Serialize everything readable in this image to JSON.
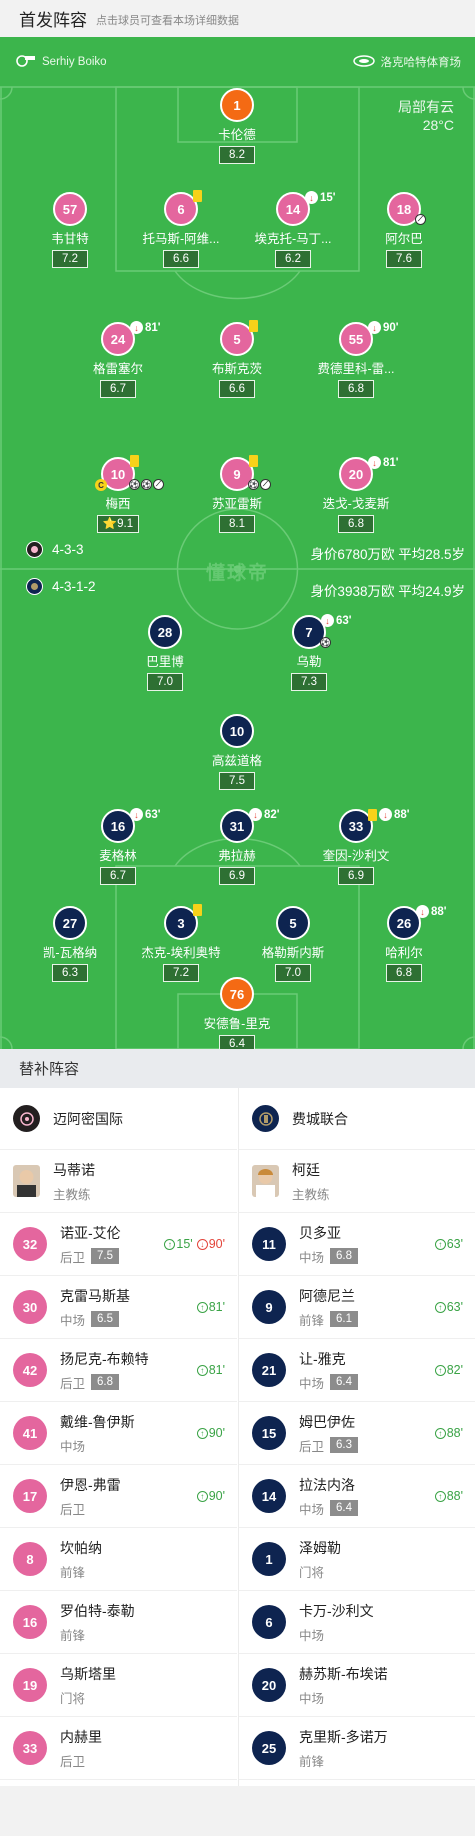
{
  "header": {
    "title": "首发阵容",
    "subtitle": "点击球员可查看本场详细数据"
  },
  "match": {
    "referee": "Serhiy Boiko",
    "stadium": "洛克哈特体育场",
    "weather": "局部有云",
    "temperature": "28°C",
    "watermark": "懂球帝"
  },
  "home": {
    "formation": "4-3-3",
    "value": "身价6780万欧 平均28.5岁"
  },
  "away": {
    "formation": "4-3-1-2",
    "value": "身价3938万欧 平均24.9岁"
  },
  "pitch_players": [
    {
      "id": "p1",
      "num": "1",
      "name": "卡伦德",
      "rating": "8.2",
      "color": "orange"
    },
    {
      "id": "p57",
      "num": "57",
      "name": "韦甘特",
      "rating": "7.2",
      "color": "pink"
    },
    {
      "id": "p6",
      "num": "6",
      "name": "托马斯-阿维...",
      "rating": "6.6",
      "color": "pink",
      "yellow": true
    },
    {
      "id": "p14",
      "num": "14",
      "name": "埃克托-马丁...",
      "rating": "6.2",
      "color": "pink",
      "sub": "15'"
    },
    {
      "id": "p18",
      "num": "18",
      "name": "阿尔巴",
      "rating": "7.6",
      "color": "pink",
      "assist": true
    },
    {
      "id": "p24",
      "num": "24",
      "name": "格雷塞尔",
      "rating": "6.7",
      "color": "pink",
      "sub": "81'"
    },
    {
      "id": "p5",
      "num": "5",
      "name": "布斯克茨",
      "rating": "6.6",
      "color": "pink",
      "yellow": true
    },
    {
      "id": "p55",
      "num": "55",
      "name": "费德里科-雷...",
      "rating": "6.8",
      "color": "pink",
      "sub": "90'"
    },
    {
      "id": "p10",
      "num": "10",
      "name": "梅西",
      "rating": "9.1",
      "color": "pink",
      "yellow": true,
      "captain": "C",
      "star": "⭐"
    },
    {
      "id": "p9",
      "num": "9",
      "name": "苏亚雷斯",
      "rating": "8.1",
      "color": "pink",
      "yellow": true
    },
    {
      "id": "p20",
      "num": "20",
      "name": "迭戈-戈麦斯",
      "rating": "6.8",
      "color": "pink",
      "sub": "81'"
    },
    {
      "id": "p28",
      "num": "28",
      "name": "巴里博",
      "rating": "7.0",
      "color": "navy"
    },
    {
      "id": "p7",
      "num": "7",
      "name": "乌勒",
      "rating": "7.3",
      "color": "navy",
      "sub": "63'"
    },
    {
      "id": "p10b",
      "num": "10",
      "name": "高兹道格",
      "rating": "7.5",
      "color": "navy"
    },
    {
      "id": "p16",
      "num": "16",
      "name": "麦格林",
      "rating": "6.7",
      "color": "navy",
      "sub": "63'"
    },
    {
      "id": "p31",
      "num": "31",
      "name": "弗拉赫",
      "rating": "6.9",
      "color": "navy",
      "sub": "82'"
    },
    {
      "id": "p33",
      "num": "33",
      "name": "奎因-沙利文",
      "rating": "6.9",
      "color": "navy",
      "yellow": true,
      "sub": "88'"
    },
    {
      "id": "p27",
      "num": "27",
      "name": "凯-瓦格纳",
      "rating": "6.3",
      "color": "navy"
    },
    {
      "id": "p3",
      "num": "3",
      "name": "杰克-埃利奥特",
      "rating": "7.2",
      "color": "navy",
      "yellow": true
    },
    {
      "id": "p5b",
      "num": "5",
      "name": "格勒斯内斯",
      "rating": "7.0",
      "color": "navy"
    },
    {
      "id": "p26",
      "num": "26",
      "name": "哈利尔",
      "rating": "6.8",
      "color": "navy",
      "sub": "88'"
    },
    {
      "id": "p76",
      "num": "76",
      "name": "安德鲁-里克",
      "rating": "6.4",
      "color": "orange"
    }
  ],
  "subs": {
    "title": "替补阵容",
    "home": {
      "team": "迈阿密国际",
      "coach": {
        "name": "马蒂诺",
        "role": "主教练"
      },
      "players": [
        {
          "num": "32",
          "name": "诺亚-艾伦",
          "pos": "后卫",
          "rating": "7.5",
          "in": "15'",
          "out": "90'"
        },
        {
          "num": "30",
          "name": "克雷马斯基",
          "pos": "中场",
          "rating": "6.5",
          "in": "81'"
        },
        {
          "num": "42",
          "name": "扬尼克-布赖特",
          "pos": "后卫",
          "rating": "6.8",
          "in": "81'"
        },
        {
          "num": "41",
          "name": "戴维-鲁伊斯",
          "pos": "中场",
          "in": "90'"
        },
        {
          "num": "17",
          "name": "伊恩-弗雷",
          "pos": "后卫",
          "in": "90'"
        },
        {
          "num": "8",
          "name": "坎帕纳",
          "pos": "前锋"
        },
        {
          "num": "16",
          "name": "罗伯特-泰勒",
          "pos": "前锋"
        },
        {
          "num": "19",
          "name": "乌斯塔里",
          "pos": "门将"
        },
        {
          "num": "33",
          "name": "内赫里",
          "pos": "后卫"
        }
      ]
    },
    "away": {
      "team": "费城联合",
      "coach": {
        "name": "柯廷",
        "role": "主教练"
      },
      "players": [
        {
          "num": "11",
          "name": "贝多亚",
          "pos": "中场",
          "rating": "6.8",
          "in": "63'"
        },
        {
          "num": "9",
          "name": "阿德尼兰",
          "pos": "前锋",
          "rating": "6.1",
          "in": "63'"
        },
        {
          "num": "21",
          "name": "让-雅克",
          "pos": "中场",
          "rating": "6.4",
          "in": "82'"
        },
        {
          "num": "15",
          "name": "姆巴伊佐",
          "pos": "后卫",
          "rating": "6.3",
          "in": "88'"
        },
        {
          "num": "14",
          "name": "拉法内洛",
          "pos": "中场",
          "rating": "6.4",
          "in": "88'"
        },
        {
          "num": "1",
          "name": "泽姆勒",
          "pos": "门将"
        },
        {
          "num": "6",
          "name": "卡万-沙利文",
          "pos": "中场"
        },
        {
          "num": "20",
          "name": "赫苏斯-布埃诺",
          "pos": "中场"
        },
        {
          "num": "25",
          "name": "克里斯-多诺万",
          "pos": "前锋"
        }
      ]
    }
  }
}
